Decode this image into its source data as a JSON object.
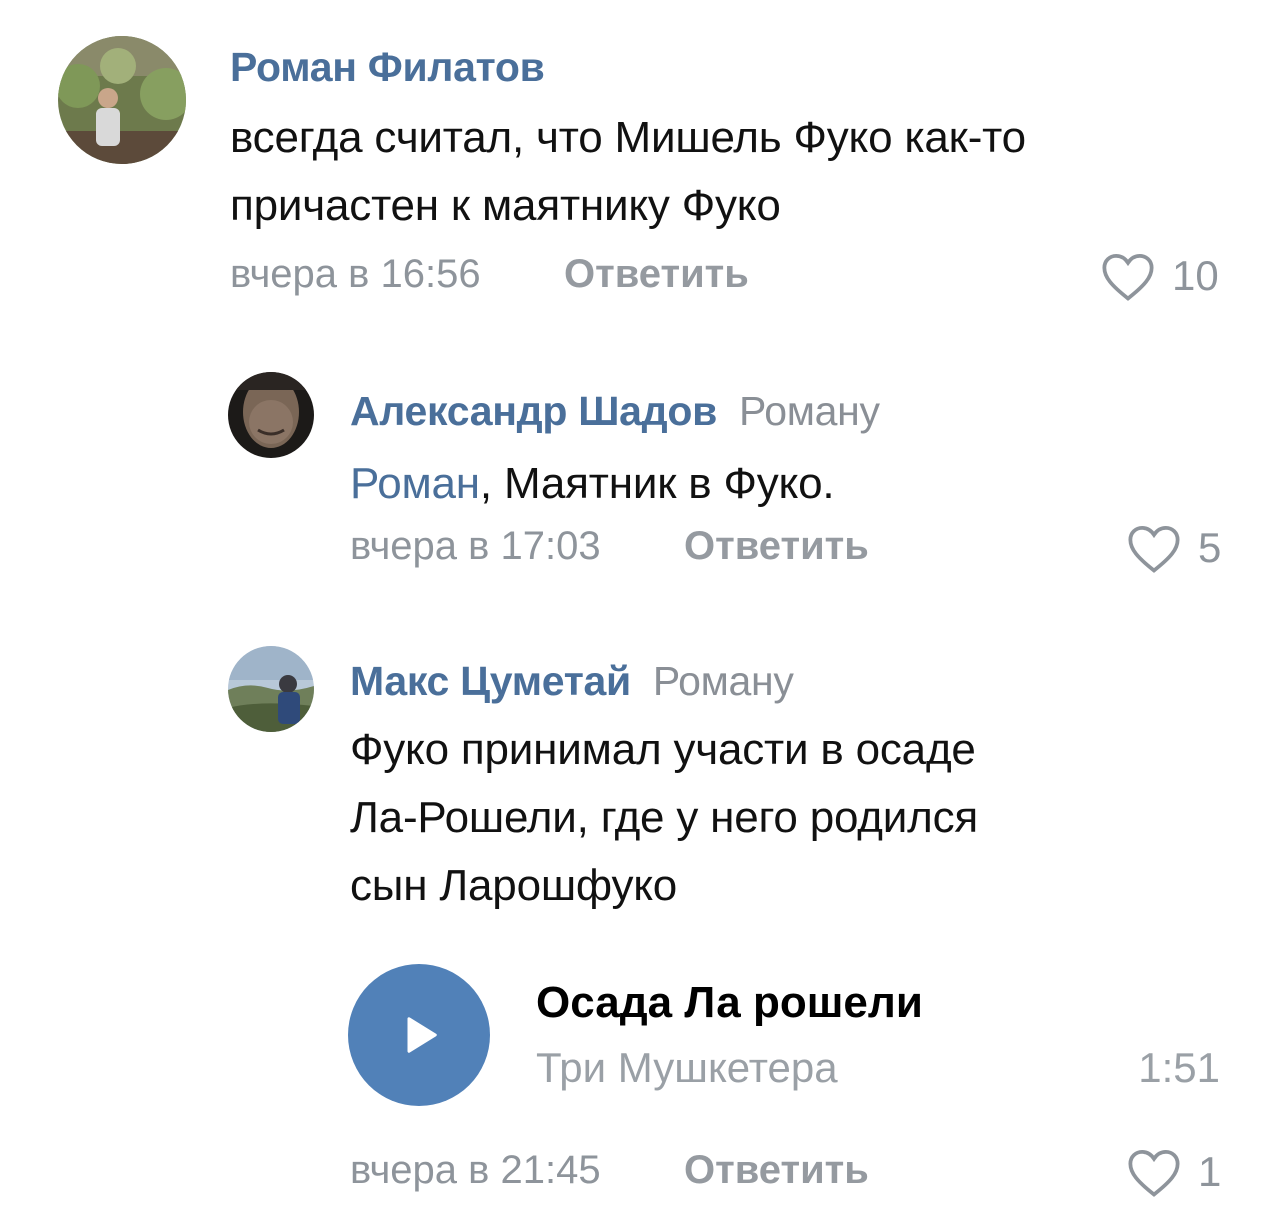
{
  "comments": [
    {
      "author": "Роман Филатов",
      "text_lines": [
        "всегда считал, что Мишель Фуко как-то",
        "причастен к маятнику Фуко"
      ],
      "timestamp": "вчера в 16:56",
      "reply_label": "Ответить",
      "likes": "10"
    },
    {
      "author": "Александр Шадов",
      "reply_to": "Роману",
      "mention": "Роман",
      "text": ", Маятник в Фуко.",
      "timestamp": "вчера в 17:03",
      "reply_label": "Ответить",
      "likes": "5"
    },
    {
      "author": "Макс Цуметай",
      "reply_to": "Роману",
      "text_lines": [
        "Фуко принимал участи в осаде",
        "Ла-Рошели, где у него родился",
        "сын Ларошфуко"
      ],
      "audio": {
        "title": "Осада Ла рошели",
        "artist": "Три Мушкетера",
        "duration": "1:51"
      },
      "timestamp": "вчера в 21:45",
      "reply_label": "Ответить",
      "likes": "1"
    }
  ],
  "colors": {
    "link": "#4a6f9a",
    "secondary": "#8e949b",
    "accent": "#5181b8"
  },
  "icons": [
    "heart-icon",
    "play-icon"
  ]
}
